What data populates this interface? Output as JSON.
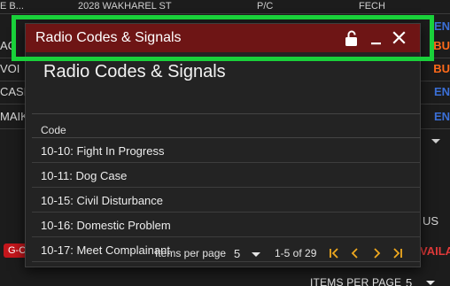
{
  "background": {
    "top_fragments": [
      "E B...",
      "2028 WAKHAREL ST",
      "P/C",
      "FECH"
    ],
    "rows": [
      {
        "left": "AC",
        "right": "BU"
      },
      {
        "left": "VOI",
        "right": "BU"
      },
      {
        "left": "CASE",
        "right": "EN"
      },
      {
        "left": "MAIK",
        "right": "EN"
      }
    ],
    "right_first": "EN",
    "us_text": "US",
    "badge": "G-C",
    "avail_text": "VAILA",
    "items_per_page_label": "ITEMS PER PAGE",
    "items_per_page_value": "5"
  },
  "dialog": {
    "title": "Radio Codes & Signals",
    "heading": "Radio Codes & Signals",
    "column_header": "Code",
    "rows": [
      {
        "label": "10-10: Fight In Progress"
      },
      {
        "label": "10-11: Dog Case"
      },
      {
        "label": "10-15: Civil Disturbance"
      },
      {
        "label": "10-16: Domestic Problem"
      },
      {
        "label": "10-17: Meet Complainant"
      }
    ],
    "paginator": {
      "items_per_page_label": "Items per page",
      "items_per_page_value": "5",
      "range_label": "1-5 of 29"
    }
  },
  "colors": {
    "header": "#6e1515",
    "accent": "#f0a91f",
    "highlight": "#19d13a"
  },
  "icons": {
    "header": [
      "lock-open-icon",
      "minimize-icon",
      "close-icon"
    ],
    "pager": [
      "first-page-icon",
      "previous-page-icon",
      "next-page-icon",
      "last-page-icon"
    ]
  }
}
